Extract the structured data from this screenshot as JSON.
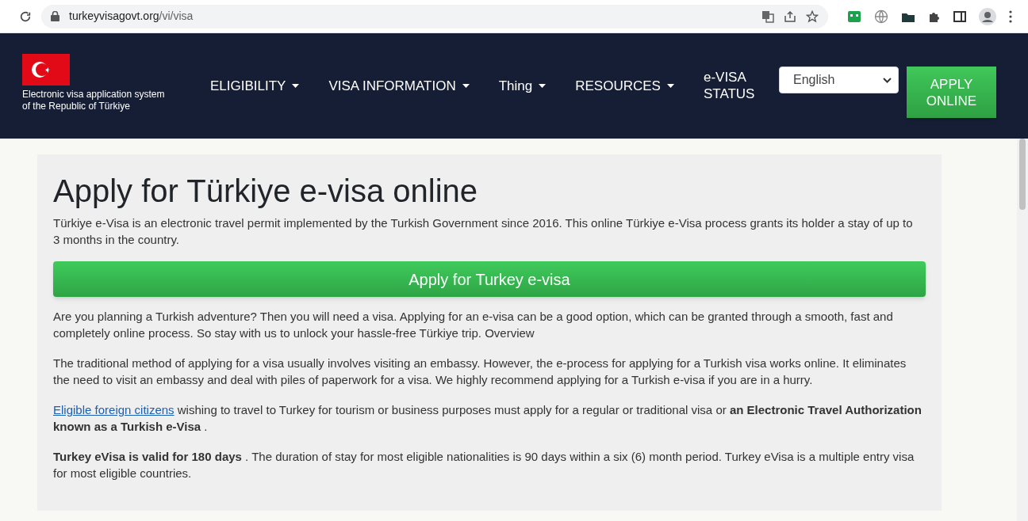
{
  "browser": {
    "url_host": "turkeyvisagovt.org",
    "url_path": "/vi/visa"
  },
  "header": {
    "logo_caption": "Electronic visa application system of the Republic of Türkiye",
    "nav": [
      {
        "label": "ELIGIBILITY",
        "dropdown": true
      },
      {
        "label": "VISA INFORMATION",
        "dropdown": true
      },
      {
        "label": "Thing",
        "dropdown": true
      },
      {
        "label": "RESOURCES",
        "dropdown": true
      },
      {
        "label": "e-VISA STATUS",
        "dropdown": false
      }
    ],
    "language": "English",
    "apply_button": "APPLY ONLINE"
  },
  "main": {
    "title": "Apply for Türkiye e-visa online",
    "intro": "Türkiye e-Visa is an electronic travel permit implemented by the Turkish Government since 2016. This online Türkiye e-Visa process grants its holder a stay of up to 3 months in the country.",
    "cta": "Apply for Turkey e-visa",
    "paragraphs": [
      {
        "text": "Are you planning a Turkish adventure? Then you will need a visa. Applying for an e-visa can be a good option, which can be granted through a smooth, fast and completely online process. So stay with us to unlock your hassle-free Türkiye trip. Overview"
      },
      {
        "text": "The traditional method of applying for a visa usually involves visiting an embassy. However, the e-process for applying for a Turkish visa works online. It eliminates the need to visit an embassy and deal with piles of paperwork for a visa. We highly recommend applying for a Turkish e-visa if you are in a hurry."
      },
      {
        "link": "Eligible foreign citizens",
        "text": " wishing to travel to Turkey for tourism or business purposes must apply for a regular or traditional visa or **an Electronic Travel Authorization known as a Turkish e-Visa** ."
      },
      {
        "text": "**Turkey eVisa is valid for 180 days** . The duration of stay for most eligible nationalities is 90 days within a six (6) month period. Turkey eVisa is a multiple entry visa for most eligible countries."
      }
    ]
  }
}
